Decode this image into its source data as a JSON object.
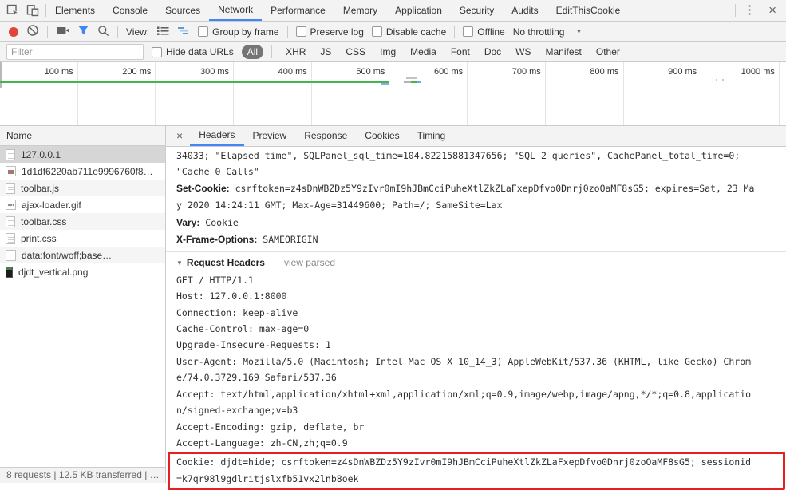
{
  "colors": {
    "accent_blue": "#4285f4",
    "record_red": "#e0443a",
    "timeline_green": "#46b44c",
    "annotation_red": "#e62020",
    "chip_selected_bg": "#757575"
  },
  "icons": {
    "kebab": "⋮",
    "close": "×",
    "panel_close": "×",
    "dropdown_arrow": "▼",
    "disclosure": "▼"
  },
  "tabbar": {
    "tabs": [
      "Elements",
      "Console",
      "Sources",
      "Network",
      "Performance",
      "Memory",
      "Application",
      "Security",
      "Audits",
      "EditThisCookie"
    ],
    "active": "Network"
  },
  "toolbar": {
    "view_label": "View:",
    "group_by_frame": "Group by frame",
    "preserve_log": "Preserve log",
    "disable_cache": "Disable cache",
    "offline": "Offline",
    "throttling": "No throttling"
  },
  "filterbar": {
    "placeholder": "Filter",
    "hide_data_urls": "Hide data URLs",
    "chips": [
      "All",
      "XHR",
      "JS",
      "CSS",
      "Img",
      "Media",
      "Font",
      "Doc",
      "WS",
      "Manifest",
      "Other"
    ],
    "active_chip": "All"
  },
  "overview": {
    "ticks": [
      "100 ms",
      "200 ms",
      "300 ms",
      "400 ms",
      "500 ms",
      "600 ms",
      "700 ms",
      "800 ms",
      "900 ms",
      "1000 ms"
    ]
  },
  "requests": {
    "column": "Name",
    "rows": [
      {
        "name": "127.0.0.1",
        "icon": "document",
        "selected": true
      },
      {
        "name": "1d1df6220ab711e9996760f8…",
        "icon": "image"
      },
      {
        "name": "toolbar.js",
        "icon": "document"
      },
      {
        "name": "ajax-loader.gif",
        "icon": "gif-image"
      },
      {
        "name": "toolbar.css",
        "icon": "document"
      },
      {
        "name": "print.css",
        "icon": "document"
      },
      {
        "name": "data:font/woff;base…",
        "icon": "blank"
      },
      {
        "name": "djdt_vertical.png",
        "icon": "dark-image"
      }
    ]
  },
  "detail": {
    "tabs": [
      "Headers",
      "Preview",
      "Response",
      "Cookies",
      "Timing"
    ],
    "active_tab": "Headers",
    "overflow_value": "34033; \"Elapsed time\", SQLPanel_sql_time=104.82215881347656; \"SQL 2 queries\", CachePanel_total_time=0; \"Cache 0 Calls\"",
    "response_headers": [
      {
        "name": "Set-Cookie:",
        "value": "csrftoken=z4sDnWBZDz5Y9zIvr0mI9hJBmCciPuheXtlZkZLaFxepDfvo0Dnrj0zoOaMF8sG5; expires=Sat, 23 May 2020 14:24:11 GMT; Max-Age=31449600; Path=/; SameSite=Lax"
      },
      {
        "name": "Vary:",
        "value": "Cookie"
      },
      {
        "name": "X-Frame-Options:",
        "value": "SAMEORIGIN"
      }
    ],
    "request_headers_title": "Request Headers",
    "view_parsed_label": "view parsed",
    "request_raw": [
      "GET / HTTP/1.1",
      "Host: 127.0.0.1:8000",
      "Connection: keep-alive",
      "Cache-Control: max-age=0",
      "Upgrade-Insecure-Requests: 1",
      "User-Agent: Mozilla/5.0 (Macintosh; Intel Mac OS X 10_14_3) AppleWebKit/537.36 (KHTML, like Gecko) Chrome/74.0.3729.169 Safari/537.36",
      "Accept: text/html,application/xhtml+xml,application/xml;q=0.9,image/webp,image/apng,*/*;q=0.8,application/signed-exchange;v=b3",
      "Accept-Encoding: gzip, deflate, br",
      "Accept-Language: zh-CN,zh;q=0.9"
    ],
    "highlighted_header": "Cookie: djdt=hide; csrftoken=z4sDnWBZDz5Y9zIvr0mI9hJBmCciPuheXtlZkZLaFxepDfvo0Dnrj0zoOaMF8sG5; sessionid=k7qr98l9gdlritjslxfb51vx2lnb8oek"
  },
  "statusbar": {
    "summary": "8 requests | 12.5 KB transferred | …"
  }
}
